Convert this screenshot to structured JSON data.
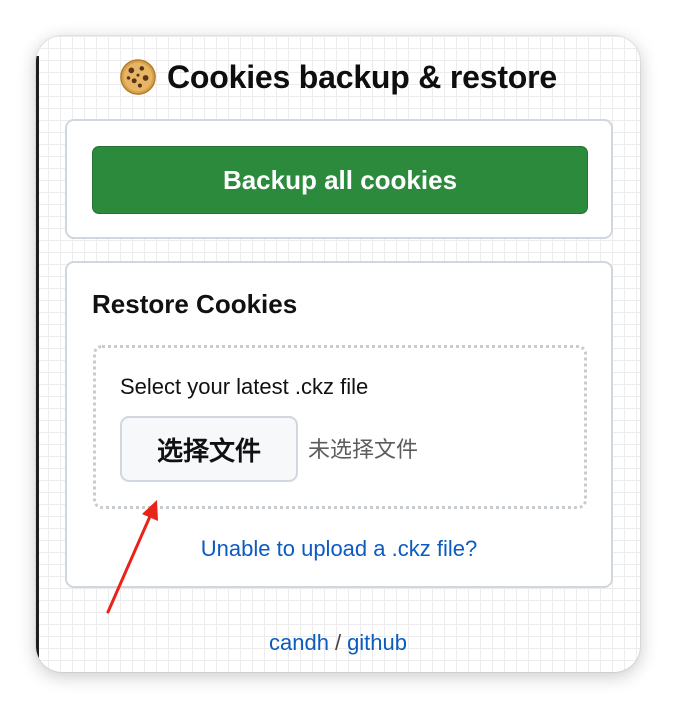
{
  "header": {
    "title": "Cookies backup & restore",
    "icon": "cookie-icon"
  },
  "backup": {
    "button_label": "Backup all cookies",
    "accent_color": "#2c8a3d"
  },
  "restore": {
    "heading": "Restore Cookies",
    "select_label": "Select your latest .ckz file",
    "file_button_label": "选择文件",
    "no_file_text": "未选择文件",
    "unable_link": "Unable to upload a .ckz file?"
  },
  "footer": {
    "author_link": "candh",
    "separator": "/",
    "github_link": "github"
  },
  "annotation": {
    "type": "arrow",
    "color": "#e8231a",
    "points_to": "file-button"
  }
}
